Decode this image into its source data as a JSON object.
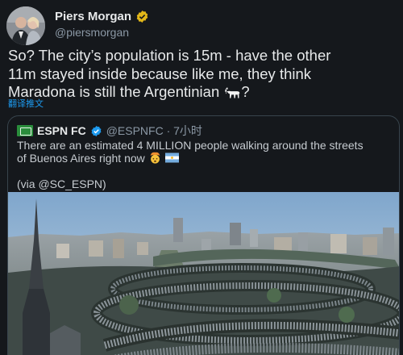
{
  "tweet": {
    "author": {
      "name": "Piers Morgan",
      "handle": "@piersmorgan",
      "avatar_icon": "avatar-photo",
      "verified": true
    },
    "text_line1": "So? The city’s population is 15m - have the other",
    "text_line2": "11m stayed inside because like me, they think",
    "text_line3": "Maradona is still the Argentinian",
    "text_end": "?",
    "goat_icon": "goat-emoji",
    "translate_label": "翻译推文"
  },
  "quote": {
    "logo_icon": "espnfc-logo",
    "name": "ESPN FC",
    "verified": true,
    "handle_time": "@ESPNFC · 7小时",
    "text_line1": "There are an estimated 4 MILLION people walking around the streets",
    "text_line2": "of Buenos Aires right now",
    "emoji1": "exploding-head-emoji",
    "emoji2": "argentina-flag-emoji",
    "via": "(via @SC_ESPN)",
    "image": "aerial-crowd-photo"
  },
  "colors": {
    "background": "#15181c",
    "text": "#e7e9ea",
    "secondary": "#8b98a5",
    "link": "#1d9bf0",
    "verified_gold": "#e2b719",
    "verified_blue": "#1d9bf0"
  }
}
